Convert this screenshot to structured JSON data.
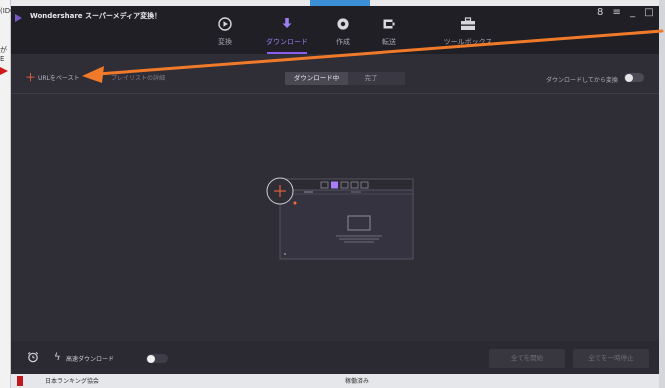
{
  "desktop": {
    "left_fragments": [
      "(IDO",
      "がE"
    ],
    "taskbar": {
      "left_text": "日本ランキング協会",
      "right_text": "稼働済み"
    }
  },
  "app": {
    "title": "Wondershare スーパーメディア変換！",
    "window_controls": "8 ≡ _ □ ✕",
    "nav": [
      {
        "label": "変換",
        "icon": "play-circle-icon"
      },
      {
        "label": "ダウンロード",
        "icon": "download-icon",
        "active": true
      },
      {
        "label": "作成",
        "icon": "burn-disc-icon"
      },
      {
        "label": "転送",
        "icon": "transfer-icon"
      },
      {
        "label": "ツールボックス",
        "icon": "toolbox-icon"
      }
    ]
  },
  "toolbar": {
    "add_url": "URLをペースト",
    "playlist": "プレイリストの詳細",
    "tabs": [
      {
        "label": "ダウンロード中",
        "active": true
      },
      {
        "label": "完了"
      }
    ],
    "convert_after_download": "ダウンロードしてから変換"
  },
  "bottom": {
    "high_speed": "高速ダウンロード",
    "start_all": "全てを開始",
    "pause_all": "全てを一時停止"
  },
  "colors": {
    "accent": "#8a5cf0",
    "plus": "#ff6a3d",
    "annotation_arrow": "#f07a2a"
  }
}
